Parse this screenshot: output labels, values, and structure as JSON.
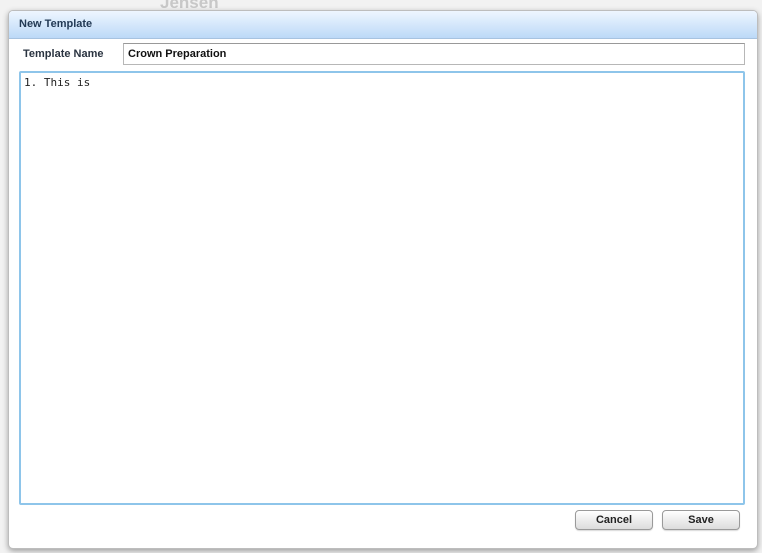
{
  "background": {
    "name_fragment": "Jensen"
  },
  "dialog": {
    "title": "New Template",
    "template_name_label": "Template Name",
    "template_name_value": "Crown Preparation",
    "body_text": "1. This is",
    "cancel_label": "Cancel",
    "save_label": "Save"
  },
  "colors": {
    "titlebar_gradient_top": "#eef6ff",
    "titlebar_gradient_bottom": "#bcd9f7",
    "focus_border": "#8ec5ea"
  }
}
